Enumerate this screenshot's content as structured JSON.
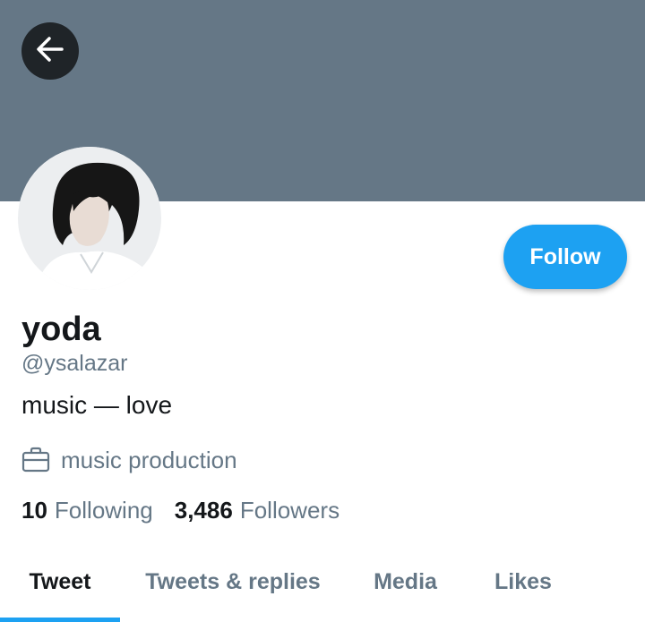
{
  "header": {
    "back_icon": "arrow-left-icon",
    "banner_color": "#657786"
  },
  "profile": {
    "name": "yoda",
    "handle": "@ysalazar",
    "bio": "music — love",
    "work": "music production",
    "work_icon": "briefcase-icon",
    "follow_label": "Follow",
    "accent_color": "#1da1f2"
  },
  "stats": {
    "following_count": "10",
    "following_label": "Following",
    "followers_count": "3,486",
    "followers_label": "Followers"
  },
  "tabs": [
    {
      "label": "Tweet",
      "active": true
    },
    {
      "label": "Tweets & replies",
      "active": false
    },
    {
      "label": "Media",
      "active": false
    },
    {
      "label": "Likes",
      "active": false
    }
  ]
}
